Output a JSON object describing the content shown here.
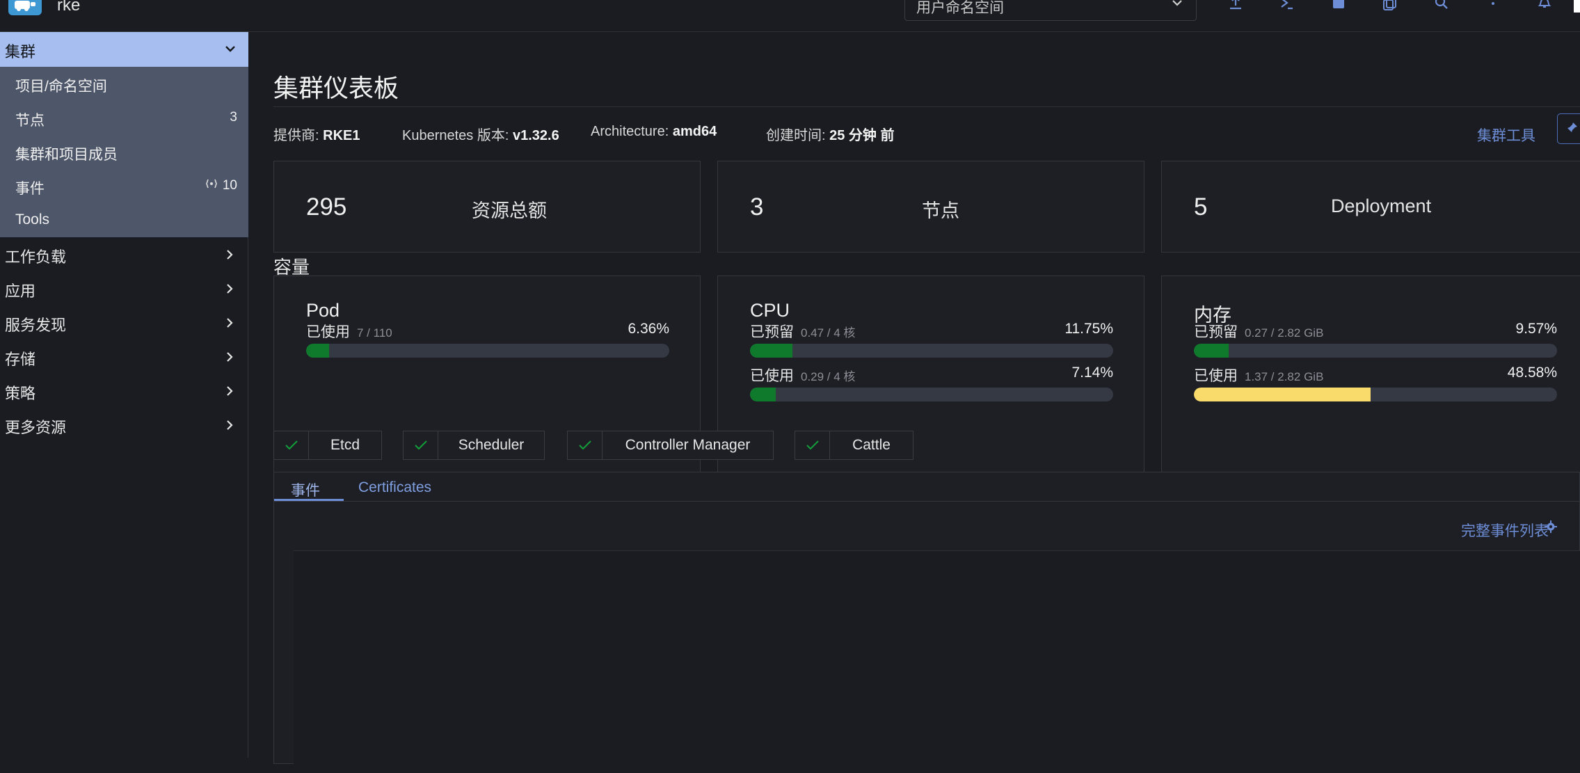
{
  "header": {
    "cluster_name": "rke",
    "namespace_select": "用户命名空间",
    "icons": [
      "upload-icon",
      "kubectl-shell-icon",
      "file-icon",
      "copy-icon",
      "search-icon",
      "more-vertical-icon",
      "bell-icon"
    ]
  },
  "sidebar": {
    "group": {
      "label": "集群",
      "items": [
        {
          "label": "项目/命名空间",
          "count": ""
        },
        {
          "label": "节点",
          "count": "3"
        },
        {
          "label": "集群和项目成员",
          "count": ""
        },
        {
          "label": "事件",
          "count": "10"
        },
        {
          "label": "Tools",
          "count": ""
        }
      ]
    },
    "items": [
      {
        "label": "工作负载"
      },
      {
        "label": "应用"
      },
      {
        "label": "服务发现"
      },
      {
        "label": "存储"
      },
      {
        "label": "策略"
      },
      {
        "label": "更多资源"
      }
    ]
  },
  "main": {
    "title": "集群仪表板",
    "meta": {
      "provider_label": "提供商:",
      "provider_value": "RKE1",
      "k8s_label": "Kubernetes 版本:",
      "k8s_value": "v1.32.6",
      "arch_label": "Architecture:",
      "arch_value": "amd64",
      "created_label": "创建时间:",
      "created_value": "25 分钟 前"
    },
    "cluster_tools": "集群工具",
    "stats": [
      {
        "value": "295",
        "label": "资源总额"
      },
      {
        "value": "3",
        "label": "节点"
      },
      {
        "value": "5",
        "label": "Deployment"
      }
    ],
    "capacity_title": "容量",
    "capacity": {
      "pod": {
        "title": "Pod",
        "used_label": "已使用",
        "used_sub": "7 / 110",
        "used_pct": "6.36%",
        "used_fraction": 0.0636
      },
      "cpu": {
        "title": "CPU",
        "reserved_label": "已预留",
        "reserved_sub": "0.47 / 4 核",
        "reserved_pct": "11.75%",
        "reserved_fraction": 0.1175,
        "used_label": "已使用",
        "used_sub": "0.29 / 4 核",
        "used_pct": "7.14%",
        "used_fraction": 0.0714
      },
      "memory": {
        "title": "内存",
        "reserved_label": "已预留",
        "reserved_sub": "0.27 / 2.82 GiB",
        "reserved_pct": "9.57%",
        "reserved_fraction": 0.0957,
        "used_label": "已使用",
        "used_sub": "1.37 / 2.82 GiB",
        "used_pct": "48.58%",
        "used_fraction": 0.4858
      }
    },
    "components": [
      "Etcd",
      "Scheduler",
      "Controller Manager",
      "Cattle"
    ],
    "tabs": [
      "事件",
      "Certificates"
    ],
    "full_event_list": "完整事件列表",
    "colors": {
      "ok_green": "#13a03a",
      "bar_green": "#0f7a2c",
      "bar_yellow": "#f8db6a",
      "accent": "#6d8ed6"
    }
  }
}
